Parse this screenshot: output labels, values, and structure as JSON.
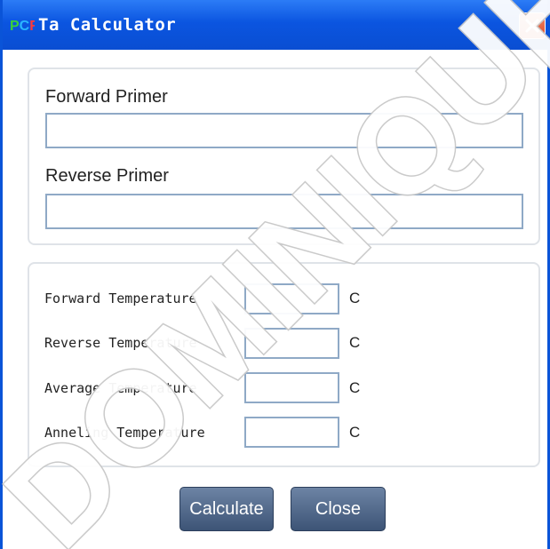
{
  "window": {
    "title": "Ta Calculator",
    "logo_text": "PCR",
    "close_icon": "close-icon"
  },
  "primers": {
    "forward_label": "Forward Primer",
    "forward_value": "",
    "reverse_label": "Reverse Primer",
    "reverse_value": ""
  },
  "temperatures": {
    "forward_label": "Forward Temperature",
    "forward_value": "",
    "reverse_label": "Reverse Temperature",
    "reverse_value": "",
    "average_label": "Average Temperature",
    "average_value": "",
    "anneling_label": "Anneling Temperature",
    "anneling_value": "",
    "unit": "C"
  },
  "buttons": {
    "calculate": "Calculate",
    "close": "Close"
  },
  "watermark": "DOMINIQUE D",
  "colors": {
    "titlebar": "#0b55e0",
    "button": "#4e6689",
    "input_border": "#8fa9c6",
    "close_button": "#dd4a26"
  }
}
